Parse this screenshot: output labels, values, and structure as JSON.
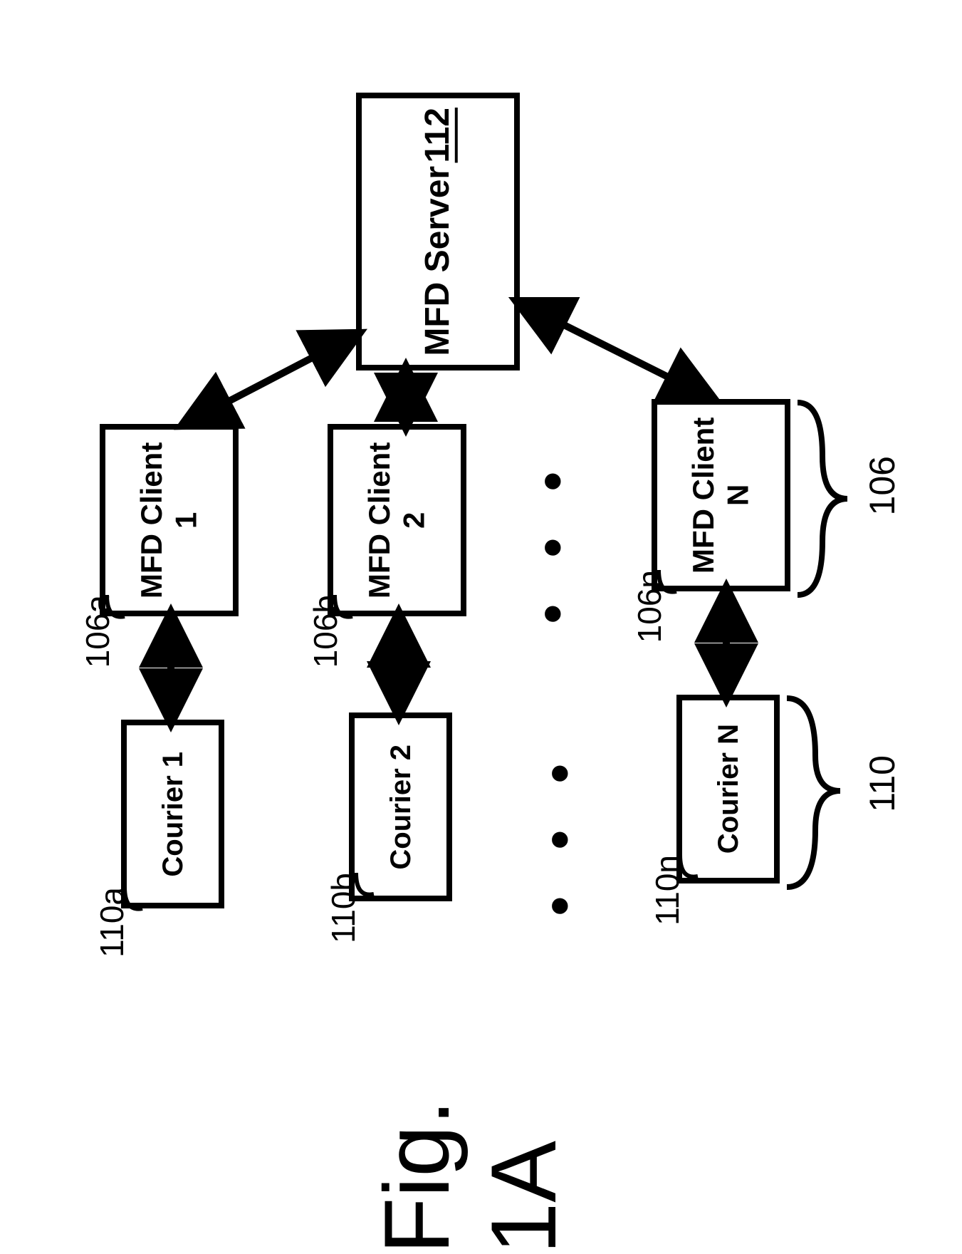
{
  "server": {
    "title": "MFD Server",
    "ref": "112"
  },
  "clients_group_ref": "106",
  "couriers_group_ref": "110",
  "clients": [
    {
      "name": "MFD Client 1",
      "ref": "106a"
    },
    {
      "name": "MFD Client 2",
      "ref": "106b"
    },
    {
      "name": "MFD Client N",
      "ref": "106n"
    }
  ],
  "couriers": [
    {
      "name": "Courier 1",
      "ref": "110a"
    },
    {
      "name": "Courier 2",
      "ref": "110b"
    },
    {
      "name": "Courier N",
      "ref": "110n"
    }
  ],
  "figure_label": "Fig. 1A",
  "ellipsis": "• • •"
}
